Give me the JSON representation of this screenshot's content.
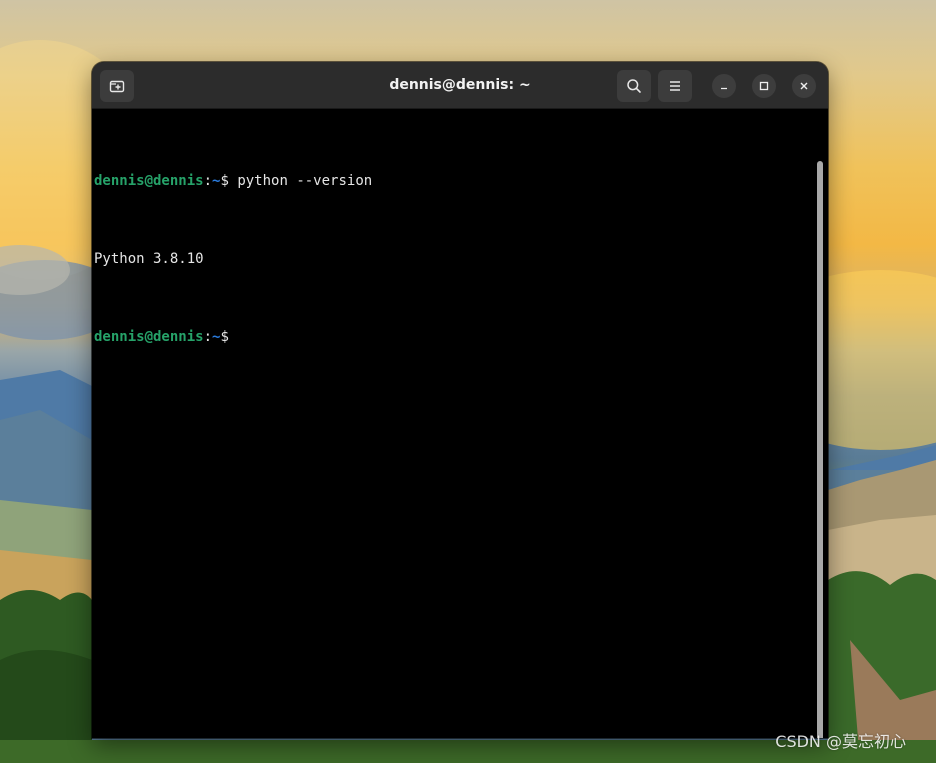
{
  "window": {
    "title": "dennis@dennis: ~"
  },
  "titlebar": {
    "new_tab_icon": "new-tab-icon",
    "search_icon": "search-icon",
    "menu_icon": "hamburger-menu-icon",
    "minimize_icon": "minimize-icon",
    "maximize_icon": "maximize-icon",
    "close_icon": "close-icon"
  },
  "terminal": {
    "lines": [
      {
        "user_host": "dennis@dennis",
        "sep": ":",
        "path": "~",
        "prompt_char": "$",
        "command": " python --version"
      },
      {
        "output": "Python 3.8.10"
      },
      {
        "user_host": "dennis@dennis",
        "sep": ":",
        "path": "~",
        "prompt_char": "$",
        "command": ""
      }
    ]
  },
  "watermark": {
    "text": "CSDN @莫忘初心"
  },
  "colors": {
    "titlebar_bg": "#2c2c2c",
    "terminal_bg": "#000000",
    "prompt_user": "#26a269",
    "prompt_path": "#2a7bde",
    "text": "#e6e6e6"
  }
}
